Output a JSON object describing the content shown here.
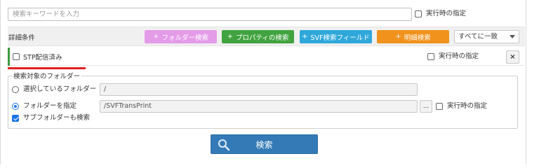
{
  "search": {
    "placeholder": "検索キーワードを入力",
    "value": "",
    "runtime_label": "実行時の指定",
    "runtime_checked": false
  },
  "conditions": {
    "title": "詳細条件",
    "buttons": {
      "folder": "フォルダー検索",
      "property": "プロパティの検索",
      "svf": "SVF検索フィールド",
      "detail": "明細検索"
    },
    "plus": "+",
    "match_select": "すべてに一致",
    "rows": [
      {
        "label": "STP配信済み",
        "checked": false,
        "runtime_label": "実行時の指定",
        "runtime_checked": false,
        "remove": "×"
      }
    ]
  },
  "folders": {
    "legend": "検索対象のフォルダー",
    "selected_folder_label": "選択しているフォルダー",
    "selected_folder_path": "/",
    "specify_folder_label": "フォルダーを指定",
    "specify_folder_path": "/SVFTransPrint",
    "browse_label": "...",
    "runtime_label": "実行時の指定",
    "runtime_checked": false,
    "subfolders_label": "サブフォルダーも検索",
    "subfolders_checked": true,
    "mode": "specify"
  },
  "submit": {
    "label": "検索"
  },
  "colors": {
    "folder_btn": "#e49be8",
    "property_btn": "#41a33f",
    "svf_btn": "#2fa8d9",
    "detail_btn": "#f0921c",
    "search_btn": "#337ab7",
    "accent_bar": "#3c9b3c",
    "underline": "#e02020"
  },
  "icons": {
    "search": "magnifier-icon",
    "dropdown": "chevron-down-icon",
    "remove": "close-icon"
  }
}
